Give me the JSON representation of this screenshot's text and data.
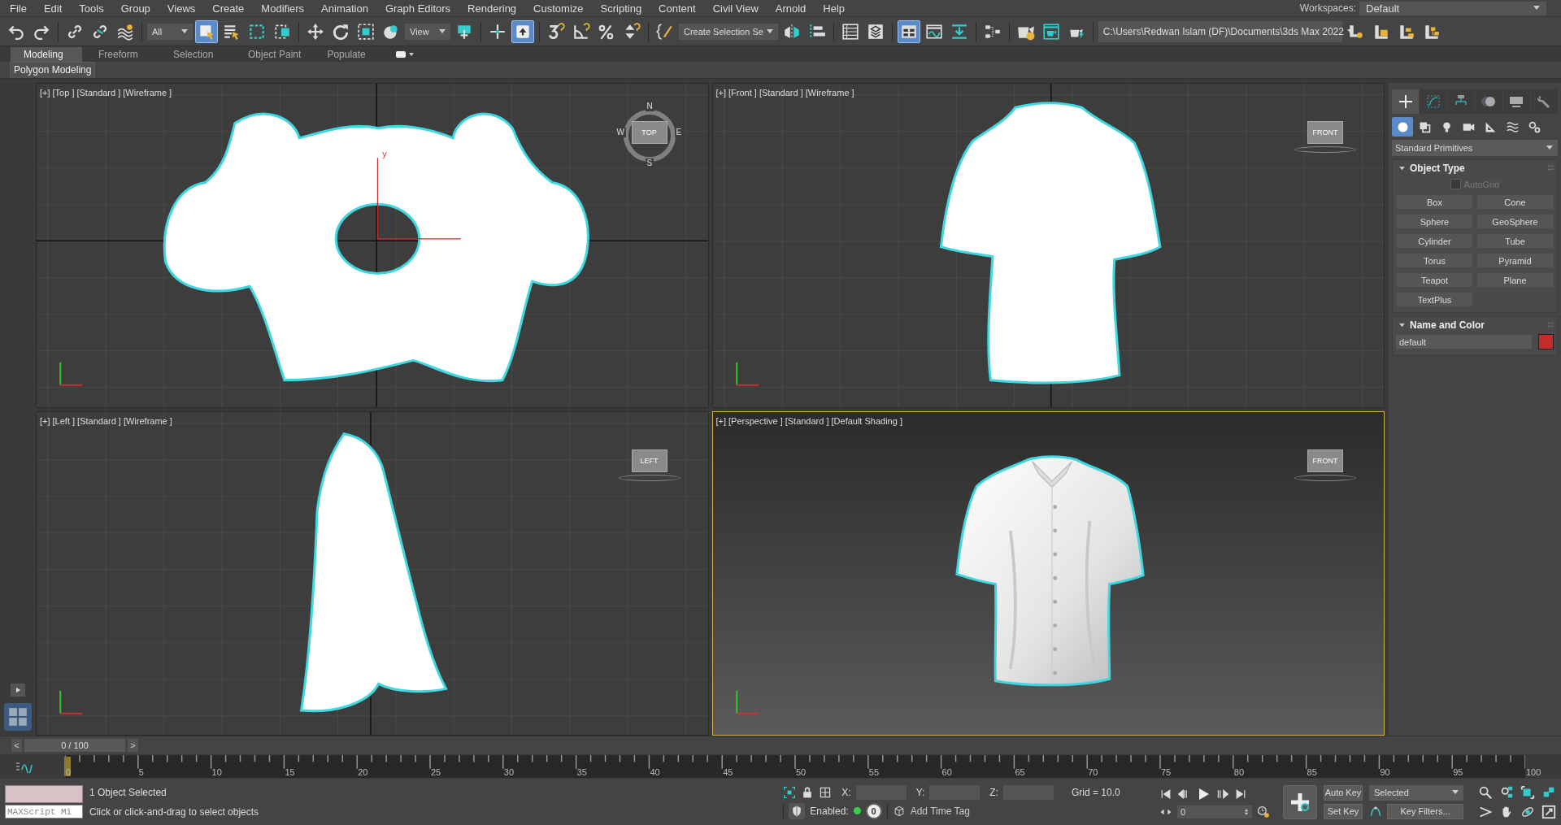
{
  "menu_bar": {
    "items": [
      "File",
      "Edit",
      "Tools",
      "Group",
      "Views",
      "Create",
      "Modifiers",
      "Animation",
      "Graph Editors",
      "Rendering",
      "Customize",
      "Scripting",
      "Content",
      "Civil View",
      "Arnold",
      "Help"
    ],
    "workspaces_label": "Workspaces:",
    "workspace": "Default"
  },
  "main_toolbar": [
    {
      "kind": "undo",
      "selected": false
    },
    {
      "kind": "redo",
      "selected": false
    },
    {
      "kind": "separator"
    },
    {
      "kind": "link",
      "selected": false
    },
    {
      "kind": "unlink",
      "selected": false
    },
    {
      "kind": "bind",
      "selected": false
    },
    {
      "kind": "separator"
    },
    {
      "kind": "dropdown",
      "value": "All"
    },
    {
      "kind": "select",
      "selected": true
    },
    {
      "kind": "select_name",
      "selected": false
    },
    {
      "kind": "rect_region",
      "selected": false
    },
    {
      "kind": "window_crossing",
      "selected": false
    },
    {
      "kind": "separator"
    },
    {
      "kind": "move",
      "selected": false
    },
    {
      "kind": "rotate",
      "selected": false
    },
    {
      "kind": "scale",
      "selected": false
    },
    {
      "kind": "placement",
      "selected": false
    },
    {
      "kind": "dropdown",
      "value": "View"
    },
    {
      "kind": "pivot",
      "selected": false
    },
    {
      "kind": "separator"
    },
    {
      "kind": "constraint",
      "selected": false
    },
    {
      "kind": "manipulate",
      "selected": true
    },
    {
      "kind": "separator"
    },
    {
      "kind": "snap",
      "selected": false
    },
    {
      "kind": "angle",
      "selected": false
    },
    {
      "kind": "percent",
      "selected": false
    },
    {
      "kind": "spinner",
      "selected": false
    },
    {
      "kind": "separator"
    },
    {
      "kind": "named_sel",
      "selected": false
    },
    {
      "kind": "dropdown",
      "value": "Create Selection Se"
    },
    {
      "kind": "mirror",
      "selected": false
    },
    {
      "kind": "align",
      "selected": false
    },
    {
      "kind": "separator"
    },
    {
      "kind": "explorer",
      "selected": false
    },
    {
      "kind": "layers",
      "selected": false
    },
    {
      "kind": "separator"
    },
    {
      "kind": "ribbon",
      "selected": true
    },
    {
      "kind": "curve",
      "selected": false
    },
    {
      "kind": "schematic",
      "selected": false
    },
    {
      "kind": "separator"
    },
    {
      "kind": "material",
      "selected": false
    },
    {
      "kind": "separator"
    },
    {
      "kind": "render_setup",
      "selected": false
    },
    {
      "kind": "render_frame",
      "selected": false
    },
    {
      "kind": "render",
      "selected": false
    },
    {
      "kind": "separator"
    },
    {
      "kind": "path",
      "value": "C:\\Users\\Redwan Islam (DF)\\Documents\\3ds Max 2022"
    },
    {
      "kind": "proj_new",
      "selected": false
    },
    {
      "kind": "proj_open",
      "selected": false
    },
    {
      "kind": "proj_tree",
      "selected": false
    },
    {
      "kind": "proj_tree2",
      "selected": false
    }
  ],
  "ribbon": {
    "tabs": [
      {
        "label": "Modeling",
        "selected": true
      },
      {
        "label": "Freeform",
        "selected": false
      },
      {
        "label": "Selection",
        "selected": false
      },
      {
        "label": "Object Paint",
        "selected": false
      },
      {
        "label": "Populate",
        "selected": false
      }
    ],
    "panel_tab": "Polygon Modeling"
  },
  "viewports": [
    {
      "kind": "top",
      "labels": [
        "[+]",
        "[Top ]",
        "[Standard ]",
        "[Wireframe ]"
      ],
      "active": false,
      "viewcube": "TOP",
      "compass": [
        "N",
        "W",
        "E",
        "S"
      ],
      "gizmo_label": "y"
    },
    {
      "kind": "front",
      "labels": [
        "[+]",
        "[Front ]",
        "[Standard ]",
        "[Wireframe ]"
      ],
      "active": false,
      "viewcube": "FRONT"
    },
    {
      "kind": "left",
      "labels": [
        "[+]",
        "[Left ]",
        "[Standard ]",
        "[Wireframe ]"
      ],
      "active": false,
      "viewcube": "LEFT"
    },
    {
      "kind": "perspective",
      "labels": [
        "[+]",
        "[Perspective ]",
        "[Standard ]",
        "[Default Shading ]"
      ],
      "active": true,
      "viewcube": "FRONT"
    }
  ],
  "command_panel": {
    "tabs": [
      {
        "kind": "create",
        "selected": true
      },
      {
        "kind": "modify",
        "selected": false
      },
      {
        "kind": "hierarchy",
        "selected": false
      },
      {
        "kind": "motion",
        "selected": false
      },
      {
        "kind": "display",
        "selected": false
      },
      {
        "kind": "utilities",
        "selected": false
      }
    ],
    "categories": [
      {
        "kind": "geometry",
        "selected": true
      },
      {
        "kind": "shapes",
        "selected": false
      },
      {
        "kind": "lights",
        "selected": false
      },
      {
        "kind": "cameras",
        "selected": false
      },
      {
        "kind": "helpers",
        "selected": false
      },
      {
        "kind": "spacewarps",
        "selected": false
      },
      {
        "kind": "systems",
        "selected": false
      }
    ],
    "primitive_type": "Standard Primitives",
    "object_type": {
      "title": "Object Type",
      "autogrid": {
        "label": "AutoGrid",
        "checked": false,
        "disabled": true
      },
      "buttons": [
        "Box",
        "Cone",
        "Sphere",
        "GeoSphere",
        "Cylinder",
        "Tube",
        "Torus",
        "Pyramid",
        "Teapot",
        "Plane",
        "TextPlus"
      ]
    },
    "name_and_color": {
      "title": "Name and Color",
      "name": "default",
      "color": "#c42b2b"
    }
  },
  "time_slider": {
    "position": "0 / 100",
    "level": 0,
    "prev": "<",
    "next": ">"
  },
  "timeline": {
    "ticks": [
      "0",
      "5",
      "10",
      "15",
      "20",
      "25",
      "30",
      "35",
      "40",
      "45",
      "50",
      "55",
      "60",
      "65",
      "70",
      "75",
      "80",
      "85",
      "90",
      "95",
      "100"
    ]
  },
  "status_bar": {
    "maxscript_placeholder": "MAXScript Mi",
    "selection": "1 Object Selected",
    "prompt": "Click or click-and-drag to select objects",
    "coords": [
      "X:",
      "Y:",
      "Z:"
    ],
    "grid": "Grid = 10.0",
    "enabled_label": "Enabled:",
    "enabled": true,
    "time_tag_count": "0",
    "add_time_tag": "Add Time Tag",
    "frame": "0",
    "auto_key": "Auto Key",
    "set_key": "Set Key",
    "key_set": "Selected",
    "key_filters": "Key Filters..."
  }
}
